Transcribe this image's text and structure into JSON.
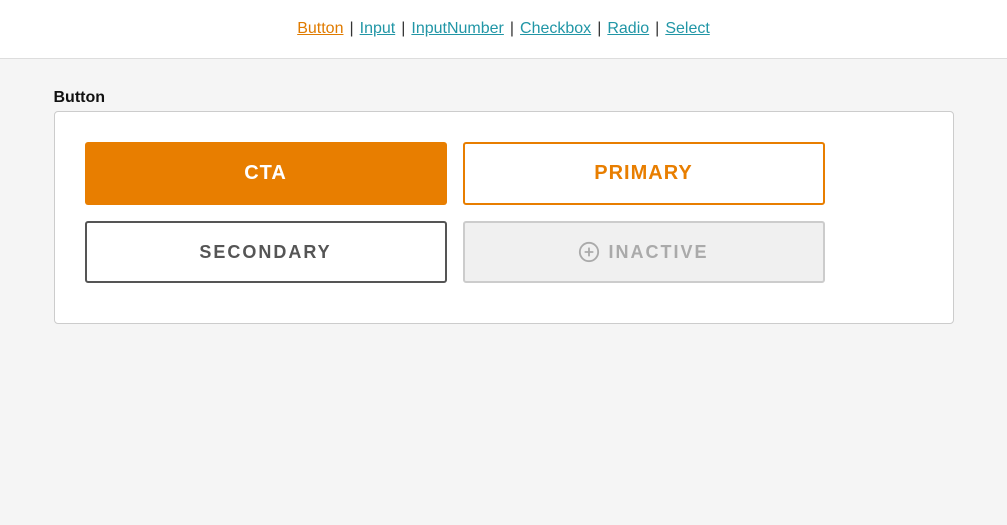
{
  "nav": {
    "items": [
      {
        "label": "Button",
        "active": true
      },
      {
        "label": "Input",
        "active": false
      },
      {
        "label": "InputNumber",
        "active": false
      },
      {
        "label": "Checkbox",
        "active": false
      },
      {
        "label": "Radio",
        "active": false
      },
      {
        "label": "Select",
        "active": false
      }
    ]
  },
  "section": {
    "title": "Button",
    "buttons": {
      "cta_label": "CTA",
      "primary_label": "PRIMARY",
      "secondary_label": "SECONDARY",
      "inactive_label": "INACTIVE"
    }
  },
  "colors": {
    "orange": "#e87e00",
    "gray": "#555",
    "inactive": "#aaa"
  }
}
